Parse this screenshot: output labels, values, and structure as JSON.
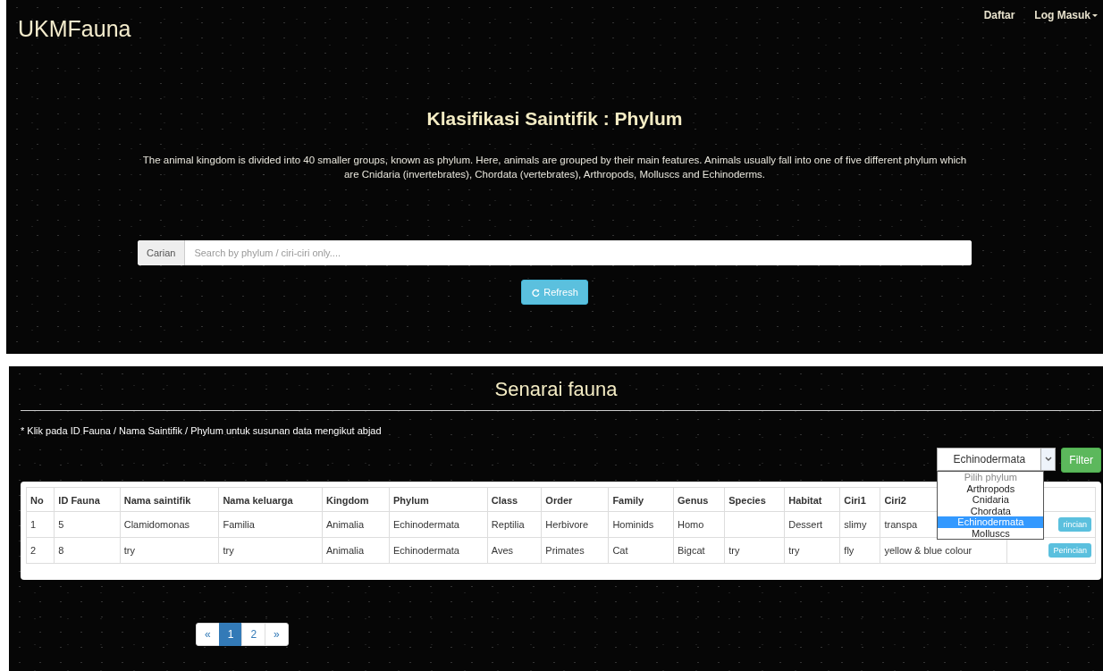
{
  "navbar": {
    "brand": "UKMFauna",
    "links": [
      {
        "label": "Daftar",
        "dropdown": false
      },
      {
        "label": "Log Masuk",
        "dropdown": true
      }
    ]
  },
  "hero": {
    "title": "Klasifikasi Saintifik : Phylum",
    "description": "The animal kingdom is divided into 40 smaller groups, known as phylum. Here, animals are grouped by their main features. Animals usually fall into one of five different phylum which are Cnidaria (invertebrates), Chordata (vertebrates), Arthropods, Molluscs and Echinoderms.",
    "search": {
      "addon": "Carian",
      "placeholder": "Search by phylum / ciri-ciri only...."
    },
    "refresh_button": "Refresh"
  },
  "list": {
    "title": "Senarai fauna",
    "note": "* Klik pada ID Fauna / Nama Saintifik / Phylum untuk susunan data mengikut abjad",
    "filter": {
      "value": "Echinodermata",
      "button": "Filter",
      "options": [
        {
          "label": "Pilih phylum",
          "disabled": true,
          "selected": false
        },
        {
          "label": "Arthropods",
          "disabled": false,
          "selected": false
        },
        {
          "label": "Cnidaria",
          "disabled": false,
          "selected": false
        },
        {
          "label": "Chordata",
          "disabled": false,
          "selected": false
        },
        {
          "label": "Echinodermata",
          "disabled": false,
          "selected": true
        },
        {
          "label": "Molluscs",
          "disabled": false,
          "selected": false
        }
      ]
    },
    "table": {
      "columns": [
        "No",
        "ID Fauna",
        "Nama saintifik",
        "Nama keluarga",
        "Kingdom",
        "Phylum",
        "Class",
        "Order",
        "Family",
        "Genus",
        "Species",
        "Habitat",
        "Ciri1",
        "Ciri2"
      ],
      "rows": [
        {
          "cells": [
            "1",
            "5",
            "Clamidomonas",
            "Familia",
            "Animalia",
            "Echinodermata",
            "Reptilia",
            "Herbivore",
            "Hominids",
            "Homo",
            "",
            "Dessert",
            "slimy",
            "transpa"
          ],
          "button": "rincian"
        },
        {
          "cells": [
            "2",
            "8",
            "try",
            "try",
            "Animalia",
            "Echinodermata",
            "Aves",
            "Primates",
            "Cat",
            "Bigcat",
            "try",
            "try",
            "fly",
            "yellow & blue colour"
          ],
          "button": "Perincian"
        }
      ]
    },
    "pagination": [
      {
        "label": "«",
        "selected": false
      },
      {
        "label": "1",
        "selected": true
      },
      {
        "label": "2",
        "selected": false
      },
      {
        "label": "»",
        "selected": false
      }
    ]
  }
}
